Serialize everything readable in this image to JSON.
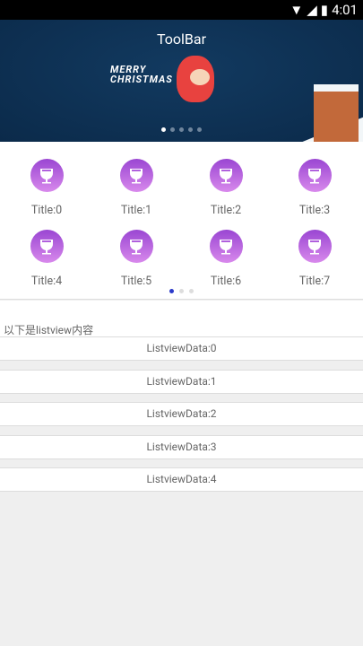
{
  "status": {
    "time": "4:01",
    "icons": [
      "wifi-icon",
      "signal-icon",
      "battery-icon"
    ]
  },
  "banner": {
    "title": "ToolBar",
    "image_text": "MERRY CHRISTMAS",
    "page_count": 5,
    "active_page": 0
  },
  "grid": {
    "items": [
      {
        "title": "Title:0"
      },
      {
        "title": "Title:1"
      },
      {
        "title": "Title:2"
      },
      {
        "title": "Title:3"
      },
      {
        "title": "Title:4"
      },
      {
        "title": "Title:5"
      },
      {
        "title": "Title:6"
      },
      {
        "title": "Title:7"
      }
    ],
    "icon": "wine-glass-icon",
    "page_count": 3,
    "active_page": 0
  },
  "list": {
    "header": "以下是listview内容",
    "items": [
      "ListviewData:0",
      "ListviewData:1",
      "ListviewData:2",
      "ListviewData:3",
      "ListviewData:4"
    ]
  },
  "colors": {
    "accent": "#2b3ac9",
    "icon_gradient_top": "#9a46d2",
    "icon_gradient_bottom": "#d889ec",
    "banner_bg": "#0b2a4a"
  }
}
